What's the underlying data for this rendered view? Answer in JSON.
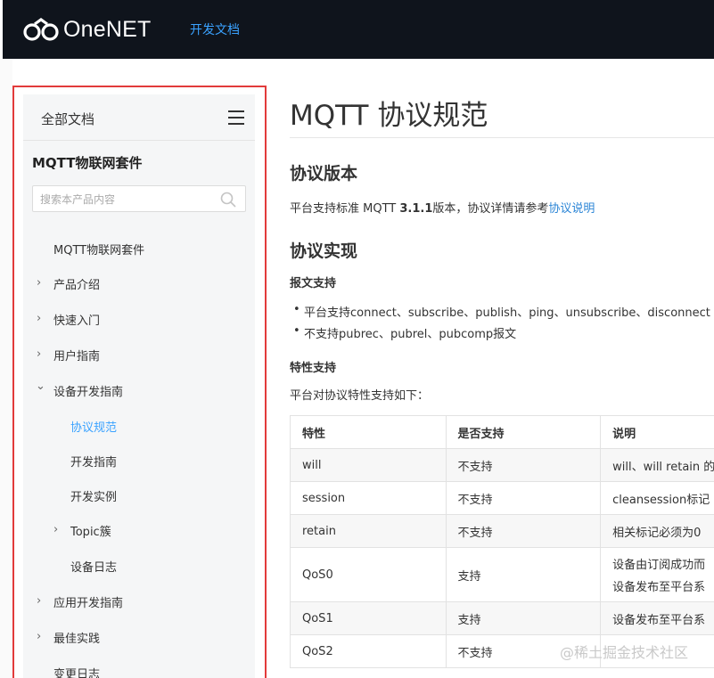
{
  "header": {
    "logo_text": "OneNET",
    "nav_doc": "开发文档"
  },
  "sidebar": {
    "all_docs": "全部文档",
    "product_title": "MQTT物联网套件",
    "search_placeholder": "搜索本产品内容",
    "items": [
      {
        "label": "MQTT物联网套件",
        "chevron": ""
      },
      {
        "label": "产品介绍",
        "chevron": "›"
      },
      {
        "label": "快速入门",
        "chevron": "›"
      },
      {
        "label": "用户指南",
        "chevron": "›"
      },
      {
        "label": "设备开发指南",
        "chevron": "⌄"
      },
      {
        "label": "协议规范",
        "chevron": ""
      },
      {
        "label": "开发指南",
        "chevron": ""
      },
      {
        "label": "开发实例",
        "chevron": ""
      },
      {
        "label": "Topic簇",
        "chevron": "›"
      },
      {
        "label": "设备日志",
        "chevron": ""
      },
      {
        "label": "应用开发指南",
        "chevron": "›"
      },
      {
        "label": "最佳实践",
        "chevron": "›"
      },
      {
        "label": "变更日志",
        "chevron": ""
      }
    ]
  },
  "main": {
    "title": "MQTT 协议规范",
    "sections": {
      "version_heading": "协议版本",
      "version_text_pre": "平台支持标准 MQTT ",
      "version_text_bold": "3.1.1",
      "version_text_post": "版本，协议详情请参考",
      "version_link": "协议说明",
      "impl_heading": "协议实现",
      "msg_support": "报文支持",
      "bullet1": "平台支持connect、subscribe、publish、ping、unsubscribe、disconnect",
      "bullet2": "不支持pubrec、pubrel、pubcomp报文",
      "feature_support": "特性支持",
      "feature_intro": "平台对协议特性支持如下："
    },
    "table": {
      "headers": [
        "特性",
        "是否支持",
        "说明"
      ],
      "rows": [
        {
          "feature": "will",
          "support": "不支持",
          "desc": "will、will retain 的"
        },
        {
          "feature": "session",
          "support": "不支持",
          "desc": "cleansession标记"
        },
        {
          "feature": "retain",
          "support": "不支持",
          "desc": "相关标记必须为0"
        },
        {
          "feature": "QoS0",
          "support": "支持",
          "desc": "设备由订阅成功而",
          "desc2": "设备发布至平台系"
        },
        {
          "feature": "QoS1",
          "support": "支持",
          "desc": "设备发布至平台系"
        },
        {
          "feature": "QoS2",
          "support": "不支持",
          "desc": ""
        }
      ]
    }
  },
  "watermark": "@稀土掘金技术社区"
}
